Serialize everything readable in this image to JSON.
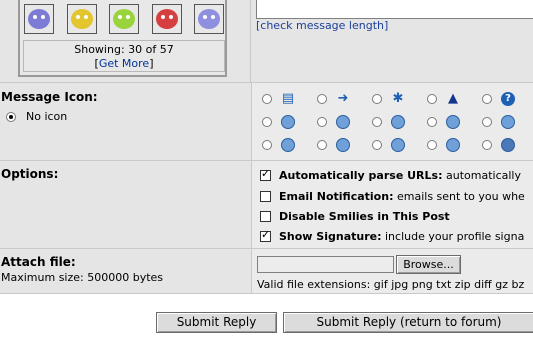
{
  "smilies": {
    "colors": [
      "#7c7cd6",
      "#e3c52e",
      "#9ad43c",
      "#d63f3f",
      "#8f8fe0"
    ],
    "showing": "Showing: 30 of 57",
    "get_more": "Get More",
    "bracket_open": "[",
    "bracket_close": "]"
  },
  "message": {
    "check_length": "[check message length]"
  },
  "message_icon": {
    "label": "Message Icon:",
    "no_icon": "No icon",
    "icons_row1": [
      "doc-icon",
      "arrow-right-icon",
      "lightbulb-icon",
      "warning-icon",
      "question-icon"
    ],
    "icons_row2": [
      "smile-icon",
      "shocked-icon",
      "laugh-icon",
      "angry-icon",
      "wink-icon"
    ],
    "icons_row3": [
      "sad-icon",
      "cry-icon",
      "tongue-icon",
      "frown-icon",
      "cool-icon"
    ]
  },
  "options": {
    "label": "Options:",
    "items": [
      {
        "title": "Automatically parse URLs:",
        "desc": "automatically",
        "checked": true
      },
      {
        "title": "Email Notification:",
        "desc": "emails sent to you whe",
        "checked": false
      },
      {
        "title": "Disable Smilies in This Post",
        "desc": "",
        "checked": false
      },
      {
        "title": "Show Signature:",
        "desc": "include your profile signa",
        "checked": true
      }
    ]
  },
  "attach": {
    "label": "Attach file:",
    "max_size": "Maximum size: 500000 bytes",
    "browse": "Browse...",
    "extensions": "Valid file extensions: gif jpg png txt zip diff gz bz"
  },
  "buttons": {
    "submit": "Submit Reply",
    "submit_return": "Submit Reply (return to forum)"
  }
}
